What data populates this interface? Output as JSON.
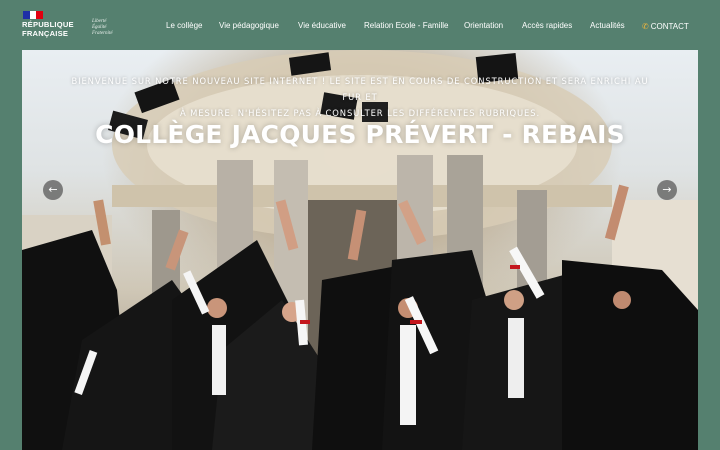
{
  "logo": {
    "line1": "RÉPUBLIQUE",
    "line2": "FRANÇAISE",
    "motto": [
      "Liberté",
      "Égalité",
      "Fraternité"
    ]
  },
  "nav": [
    {
      "label": "Le collège"
    },
    {
      "label": "Vie pédagogique"
    },
    {
      "label": "Vie éducative"
    },
    {
      "label": "Relation Ecole - Famille"
    },
    {
      "label": "Orientation"
    },
    {
      "label": "Accès rapides"
    },
    {
      "label": "Actualités"
    }
  ],
  "contact": {
    "label": "CONTACT",
    "icon": "phone-icon"
  },
  "hero": {
    "intro_line1": "Bienvenue sur notre nouveau site internet ! Le site est en cours de construction et sera enrichi au fur et",
    "intro_line2": "à mesure. N'hésitez pas à consulter les différentes rubriques.",
    "title": "COLLÈGE JACQUES PRÉVERT - REBAIS",
    "prev_icon": "chevron-left-icon",
    "next_icon": "chevron-right-icon"
  },
  "colors": {
    "page_background": "#55806f",
    "flag_blue": "#1f2fa6",
    "flag_red": "#e1000f",
    "contact_icon": "#f2b63c"
  }
}
